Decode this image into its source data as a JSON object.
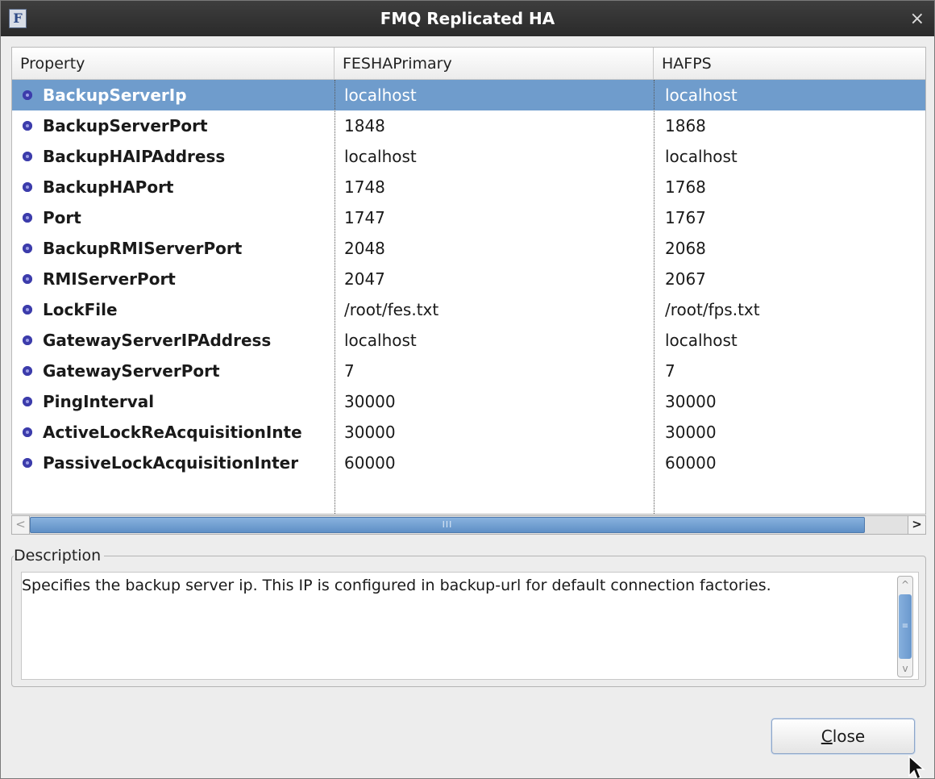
{
  "window": {
    "title": "FMQ Replicated HA",
    "app_icon_letter": "F",
    "close_glyph": "×"
  },
  "table": {
    "columns": [
      "Property",
      "FESHAPrimary",
      "HAFPS"
    ],
    "rows": [
      {
        "property": "BackupServerIp",
        "fesha": "localhost",
        "hafps": "localhost",
        "selected": true
      },
      {
        "property": "BackupServerPort",
        "fesha": "1848",
        "hafps": "1868"
      },
      {
        "property": "BackupHAIPAddress",
        "fesha": "localhost",
        "hafps": "localhost"
      },
      {
        "property": "BackupHAPort",
        "fesha": "1748",
        "hafps": "1768"
      },
      {
        "property": "Port",
        "fesha": "1747",
        "hafps": "1767"
      },
      {
        "property": "BackupRMIServerPort",
        "fesha": "2048",
        "hafps": "2068"
      },
      {
        "property": "RMIServerPort",
        "fesha": "2047",
        "hafps": "2067"
      },
      {
        "property": "LockFile",
        "fesha": "/root/fes.txt",
        "hafps": "/root/fps.txt"
      },
      {
        "property": "GatewayServerIPAddress",
        "fesha": "localhost",
        "hafps": "localhost"
      },
      {
        "property": "GatewayServerPort",
        "fesha": "7",
        "hafps": "7"
      },
      {
        "property": "PingInterval",
        "fesha": "30000",
        "hafps": "30000"
      },
      {
        "property": "ActiveLockReAcquisitionInte",
        "fesha": "30000",
        "hafps": "30000"
      },
      {
        "property": "PassiveLockAcquisitionInter",
        "fesha": "60000",
        "hafps": "60000"
      }
    ]
  },
  "hscroll": {
    "left_glyph": "<",
    "right_glyph": ">",
    "thumb_grip": "III"
  },
  "description": {
    "legend": "Description",
    "text": "Specifies the backup server ip. This IP is configured in backup-url for default connection factories.",
    "scroll_up_glyph": "^",
    "scroll_down_glyph": "v",
    "thumb_grip": "≡"
  },
  "buttons": {
    "close_mnemonic": "C",
    "close_rest": "lose"
  },
  "colors": {
    "selection": "#6f9ccc",
    "titlebar": "#2f2f2f",
    "bullet": "#3c3cab"
  },
  "icons": [
    "app-icon",
    "close-icon",
    "bullet-icon",
    "scroll-left-icon",
    "scroll-right-icon",
    "scroll-up-icon",
    "scroll-down-icon",
    "mouse-cursor-icon"
  ]
}
